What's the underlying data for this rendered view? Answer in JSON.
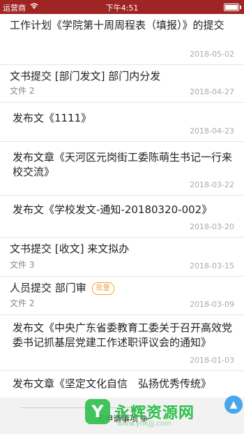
{
  "status_bar": {
    "carrier": "运营商",
    "time": "下午4:51"
  },
  "items": [
    {
      "title": "工作计划《学院第十周周程表（填报）》的提交",
      "sub": "",
      "date": "2018-05-02"
    },
    {
      "title": "文书提交 [部门发文] 部门内分发",
      "sub": "文件 2",
      "date": "2018-04-27"
    },
    {
      "title": "发布文《1111》",
      "sub": "",
      "date": "2018-04-23"
    },
    {
      "title": "发布文章《天河区元岗街工委陈萌生书记一行来校交流》",
      "sub": "",
      "date": "2018-03-22"
    },
    {
      "title": "发布文《学校发文-通知-20180320-002》",
      "sub": "",
      "date": "2018-03-20"
    },
    {
      "title": "文书提交 [收文] 来文拟办",
      "sub": "文件 3",
      "date": "2018-03-15"
    },
    {
      "title": "人员提交 部门审",
      "badge": "批量",
      "sub": "文件 2",
      "date": "2018-03-09"
    },
    {
      "title": "发布文《中央广东省委教育工委关于召开高效党委书记抓基层党建工作述职评议会的通知》",
      "sub": "",
      "date": "2018-01-03"
    },
    {
      "title": "发布文章《坚定文化自信　弘扬优秀传统》",
      "sub": "",
      "date": ""
    }
  ],
  "footer": {
    "note": "无申请事项 ⊕"
  },
  "watermark": {
    "text": "永辉资源网",
    "url": "www.yhkjjj.com"
  },
  "icons": {
    "wifi": "wifi-icon",
    "scroll_top": "arrow-up-icon"
  }
}
